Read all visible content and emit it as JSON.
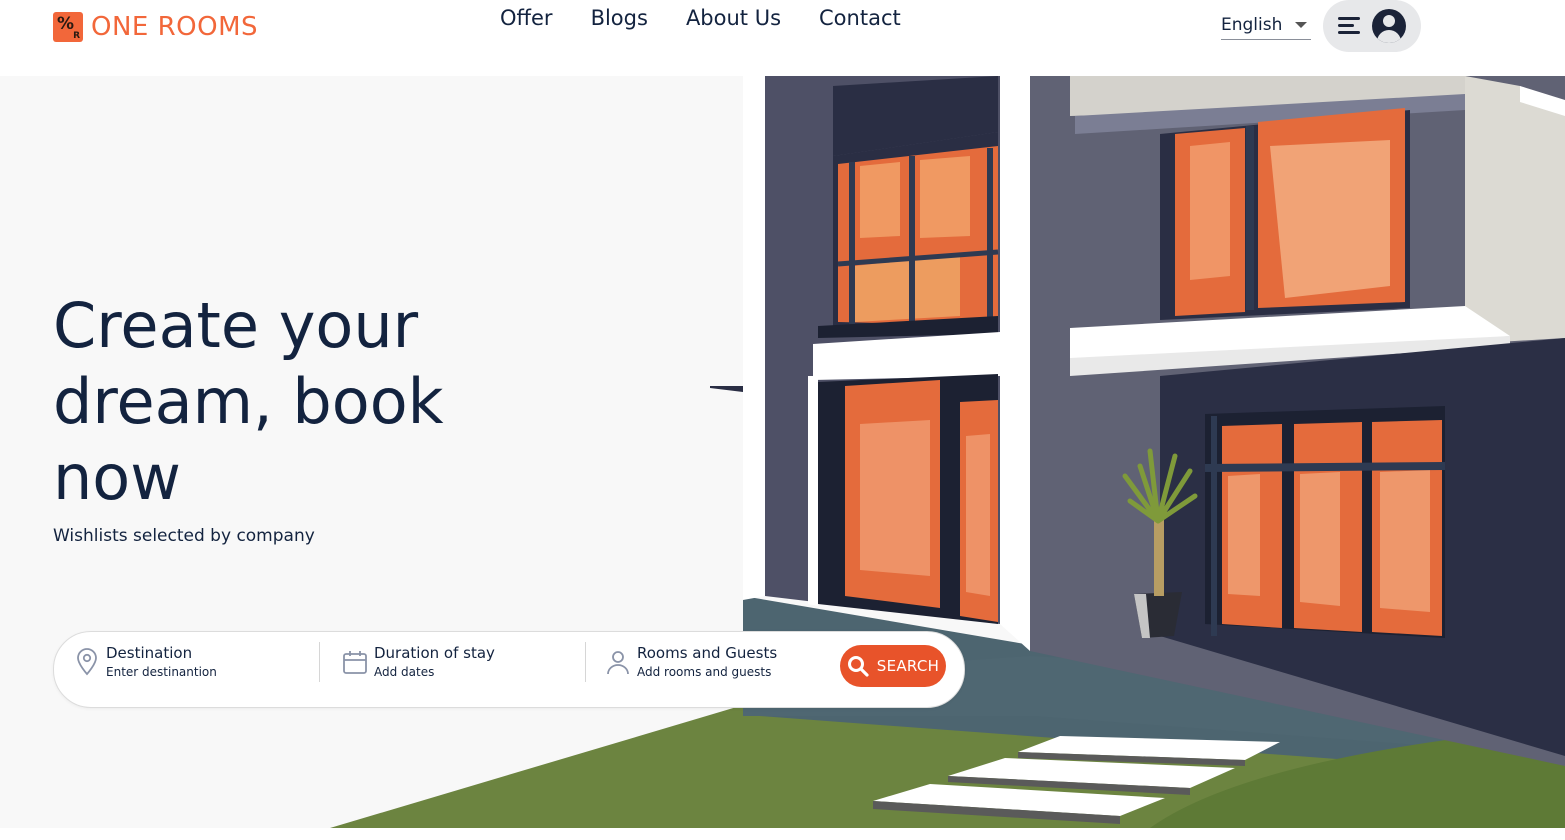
{
  "brand": {
    "name": "ONE ROOMS",
    "logo_glyph": "%",
    "logo_sub": "R",
    "accent_color": "#f2673a"
  },
  "nav": {
    "items": [
      "Offer",
      "Blogs",
      "About Us",
      "Contact"
    ]
  },
  "language": {
    "selected": "English"
  },
  "profile": {
    "menu_icon": "hamburger-icon",
    "avatar_icon": "user-avatar-icon"
  },
  "hero": {
    "headline": "Create your dream, book now",
    "subline": "Wishlists selected by company"
  },
  "search": {
    "destination": {
      "label": "Destination",
      "hint": "Enter destinantion",
      "icon": "location-pin-icon"
    },
    "duration": {
      "label": "Duration of stay",
      "hint": "Add dates",
      "icon": "calendar-icon"
    },
    "guests": {
      "label": "Rooms and Guests",
      "hint": "Add rooms and guests",
      "icon": "person-icon"
    },
    "button_label": "SEARCH",
    "button_color": "#e8532a"
  }
}
